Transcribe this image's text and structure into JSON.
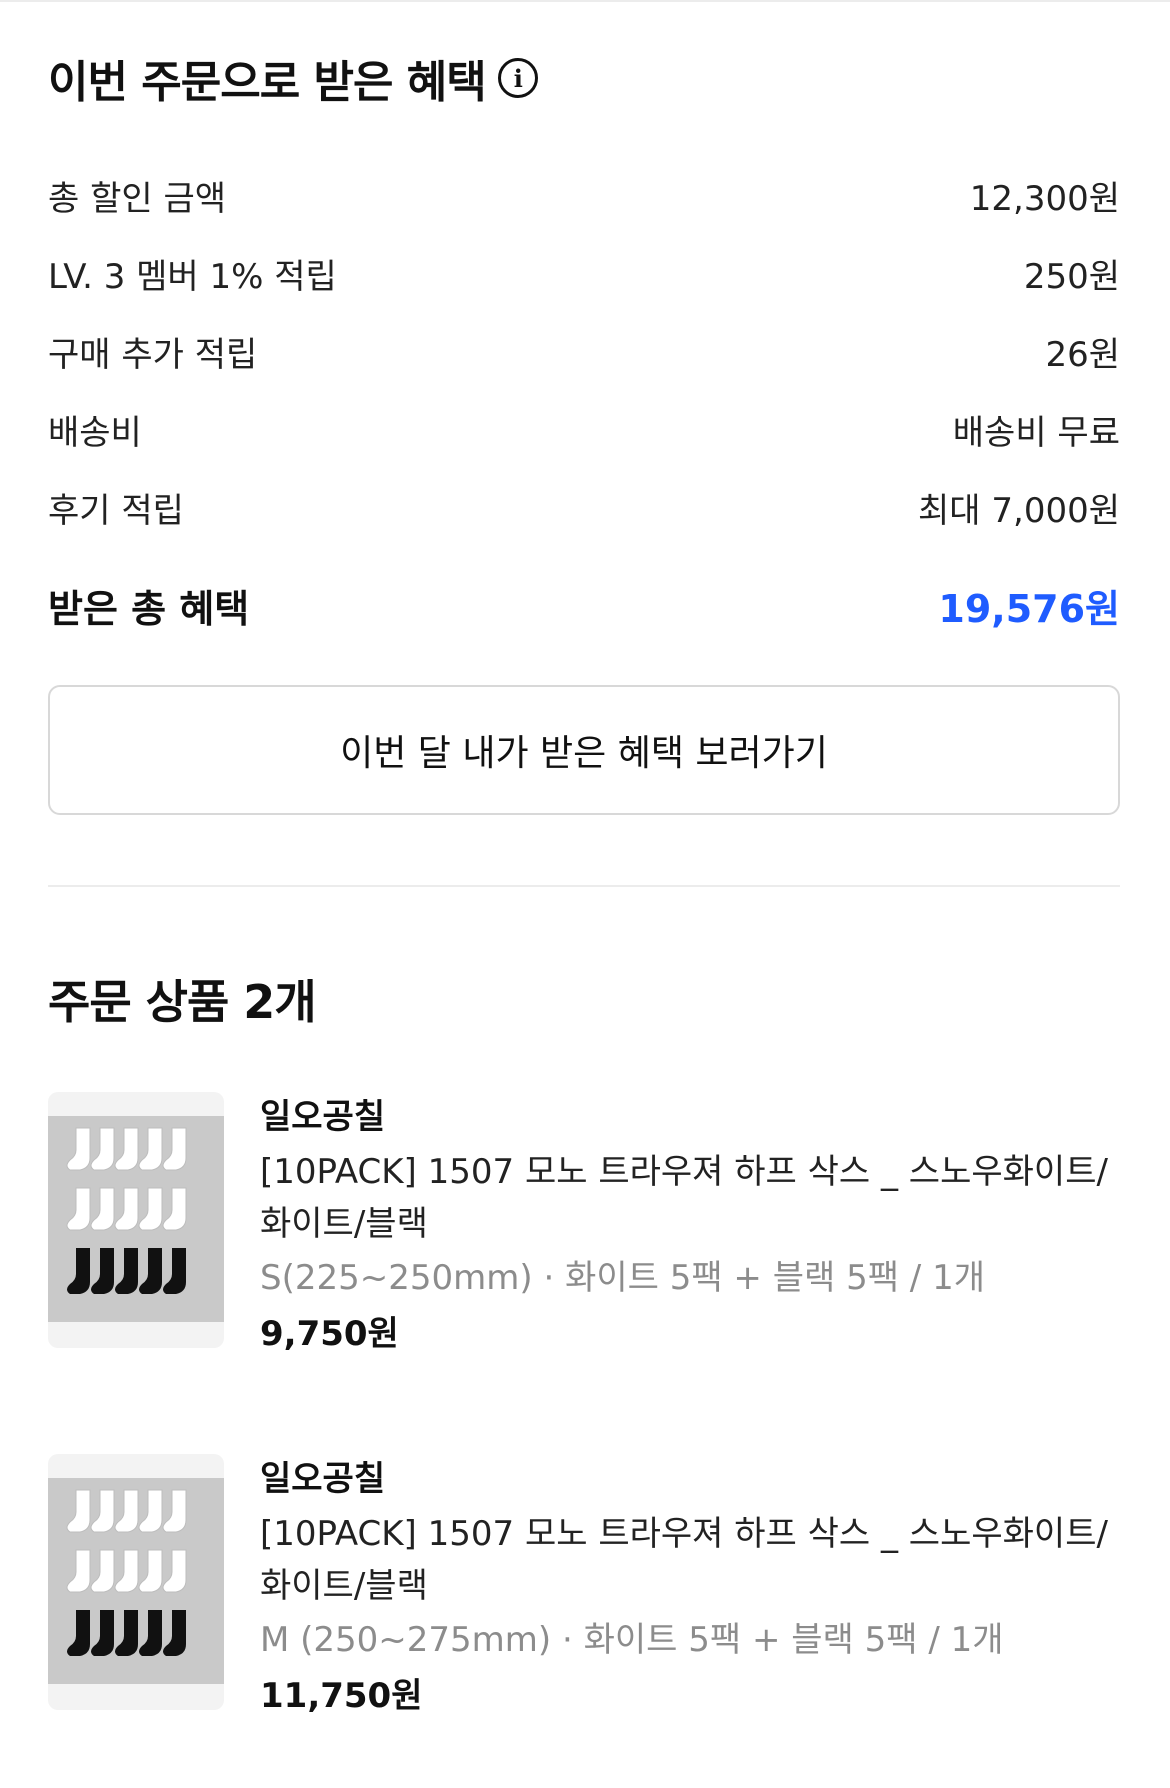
{
  "benefit": {
    "title": "이번 주문으로 받은 혜택",
    "info_icon": "info-icon",
    "rows": [
      {
        "label": "총 할인 금액",
        "value": "12,300원"
      },
      {
        "label": "LV. 3 멤버 1% 적립",
        "value": "250원"
      },
      {
        "label": "구매 추가 적립",
        "value": "26원"
      },
      {
        "label": "배송비",
        "value": "배송비 무료"
      },
      {
        "label": "후기 적립",
        "value": "최대 7,000원"
      }
    ],
    "total_label": "받은 총 혜택",
    "total_value": "19,576원",
    "button_label": "이번 달 내가 받은 혜택 보러가기"
  },
  "order": {
    "title": "주문 상품 2개",
    "items": [
      {
        "brand": "일오공칠",
        "name": "[10PACK] 1507 모노 트라우져 하프 삭스 _ 스노우화이트/화이트/블랙",
        "option": "S(225~250mm) · 화이트 5팩 + 블랙 5팩 / 1개",
        "price": "9,750원"
      },
      {
        "brand": "일오공칠",
        "name": "[10PACK] 1507 모노 트라우져 하프 삭스 _ 스노우화이트/화이트/블랙",
        "option": "M (250~275mm) · 화이트 5팩 + 블랙 5팩 / 1개",
        "price": "11,750원"
      }
    ]
  },
  "colors": {
    "accent_blue": "#1f5cff",
    "muted_text": "#8c8c8c",
    "border": "#d8d8d8"
  }
}
